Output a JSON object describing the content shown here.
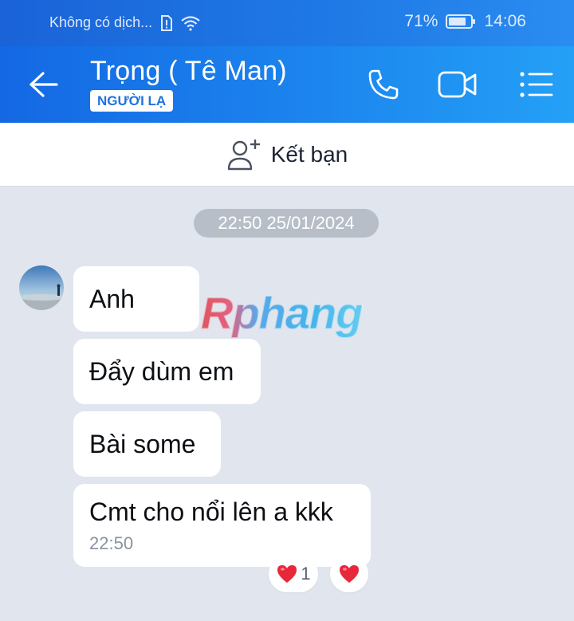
{
  "status_bar": {
    "carrier": "Không có dịch...",
    "battery": "71%",
    "time": "14:06"
  },
  "header": {
    "name": "Trọng ( Tê Man)",
    "badge": "NGƯỜI LẠ",
    "icons": [
      "back-arrow-icon",
      "phone-icon",
      "video-call-icon",
      "menu-list-icon"
    ]
  },
  "friend_bar": {
    "label": "Kết bạn",
    "icon": "add-user-icon"
  },
  "chat": {
    "date": "22:50 25/01/2024",
    "messages": [
      {
        "text": "Anh"
      },
      {
        "text": "Đẩy dùm em"
      },
      {
        "text": "Bài some"
      },
      {
        "text": "Cmt cho nổi lên a kkk",
        "time": "22:50"
      }
    ],
    "reactions": [
      {
        "icon": "heart-icon",
        "count": "1"
      },
      {
        "icon": "heart-icon",
        "count": ""
      }
    ]
  },
  "watermark": "Rphang",
  "colors": {
    "header_blue": "#1c7ae8",
    "chat_bg": "#e1e6ee",
    "bubble": "#ffffff",
    "badge_text": "#1e73df",
    "heart": "#e8283a"
  }
}
